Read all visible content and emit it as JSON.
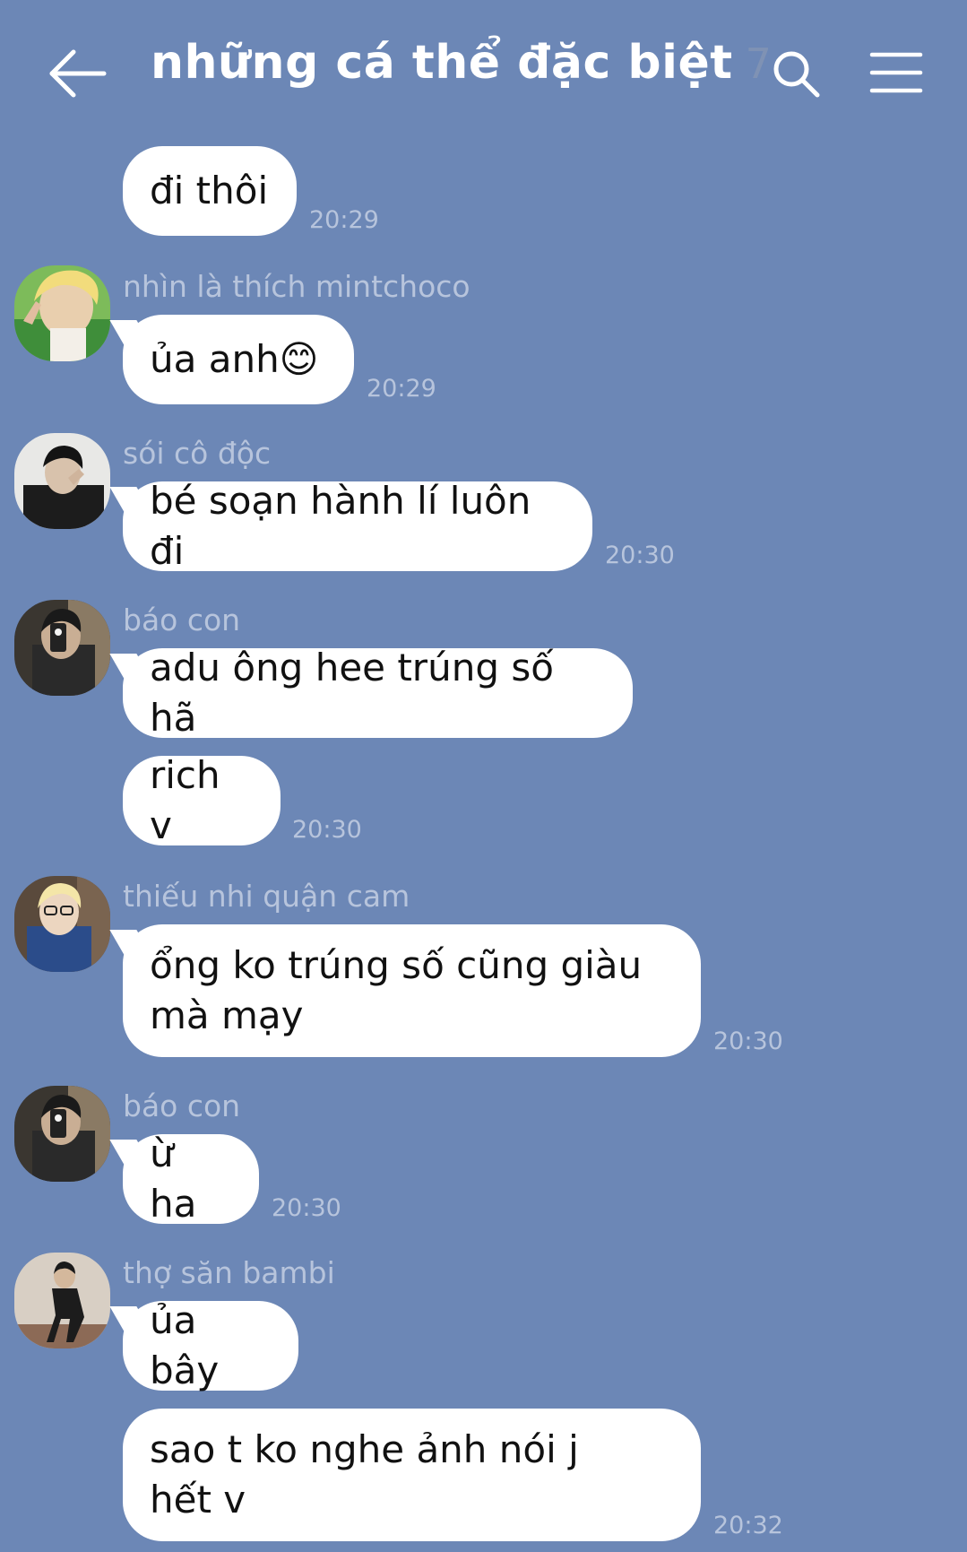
{
  "header": {
    "title": "những cá thể đặc biệt",
    "member_count": "7"
  },
  "messages": [
    {
      "sender": "",
      "text": "đi thôi",
      "time": "20:29"
    },
    {
      "sender": "nhìn là thích mintchoco",
      "text": "ủa anh😊",
      "time": "20:29"
    },
    {
      "sender": "sói cô độc",
      "text": "bé soạn hành lí luôn đi",
      "time": "20:30"
    },
    {
      "sender": "báo con",
      "text": "adu ông hee trúng số hã",
      "time": ""
    },
    {
      "sender": "",
      "text": "rich v",
      "time": "20:30"
    },
    {
      "sender": "thiếu nhi quận cam",
      "text": "ổng ko trúng số cũng giàu mà mạy",
      "time": "20:30"
    },
    {
      "sender": "báo con",
      "text": "ừ ha",
      "time": "20:30"
    },
    {
      "sender": "thợ săn bambi",
      "text": "ủa bây",
      "time": ""
    },
    {
      "sender": "",
      "text": "sao t ko nghe ảnh nói j hết v",
      "time": "20:32"
    }
  ],
  "colors": {
    "background": "#6c87b6",
    "bubble": "#ffffff",
    "meta_text": "#b7c4dc"
  },
  "icons": [
    "back-arrow-icon",
    "search-icon",
    "menu-icon"
  ]
}
